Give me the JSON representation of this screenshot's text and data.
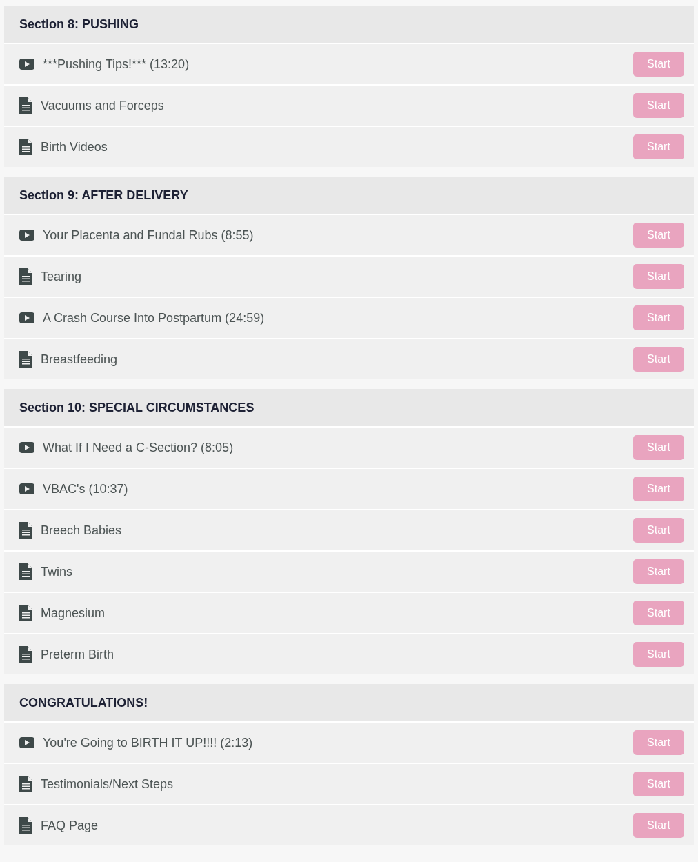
{
  "sections": [
    {
      "title": "Section 8: PUSHING",
      "lessons": [
        {
          "kind": "video",
          "title": "***Pushing Tips!*** (13:20)",
          "button": "Start"
        },
        {
          "kind": "text",
          "title": "Vacuums and Forceps",
          "button": "Start"
        },
        {
          "kind": "text",
          "title": "Birth Videos",
          "button": "Start"
        }
      ]
    },
    {
      "title": "Section 9: AFTER DELIVERY",
      "lessons": [
        {
          "kind": "video",
          "title": "Your Placenta and Fundal Rubs (8:55)",
          "button": "Start"
        },
        {
          "kind": "text",
          "title": "Tearing",
          "button": "Start"
        },
        {
          "kind": "video",
          "title": "A Crash Course Into Postpartum (24:59)",
          "button": "Start"
        },
        {
          "kind": "text",
          "title": "Breastfeeding",
          "button": "Start"
        }
      ]
    },
    {
      "title": "Section 10: SPECIAL CIRCUMSTANCES",
      "lessons": [
        {
          "kind": "video",
          "title": "What If I Need a C-Section? (8:05)",
          "button": "Start"
        },
        {
          "kind": "video",
          "title": "VBAC's (10:37)",
          "button": "Start"
        },
        {
          "kind": "text",
          "title": "Breech Babies",
          "button": "Start"
        },
        {
          "kind": "text",
          "title": "Twins",
          "button": "Start"
        },
        {
          "kind": "text",
          "title": "Magnesium",
          "button": "Start"
        },
        {
          "kind": "text",
          "title": "Preterm Birth",
          "button": "Start"
        }
      ]
    },
    {
      "title": "CONGRATULATIONS!",
      "lessons": [
        {
          "kind": "video",
          "title": "You're Going to BIRTH IT UP!!!! (2:13)",
          "button": "Start"
        },
        {
          "kind": "text",
          "title": "Testimonials/Next Steps",
          "button": "Start"
        },
        {
          "kind": "text",
          "title": "FAQ Page",
          "button": "Start"
        }
      ]
    }
  ]
}
